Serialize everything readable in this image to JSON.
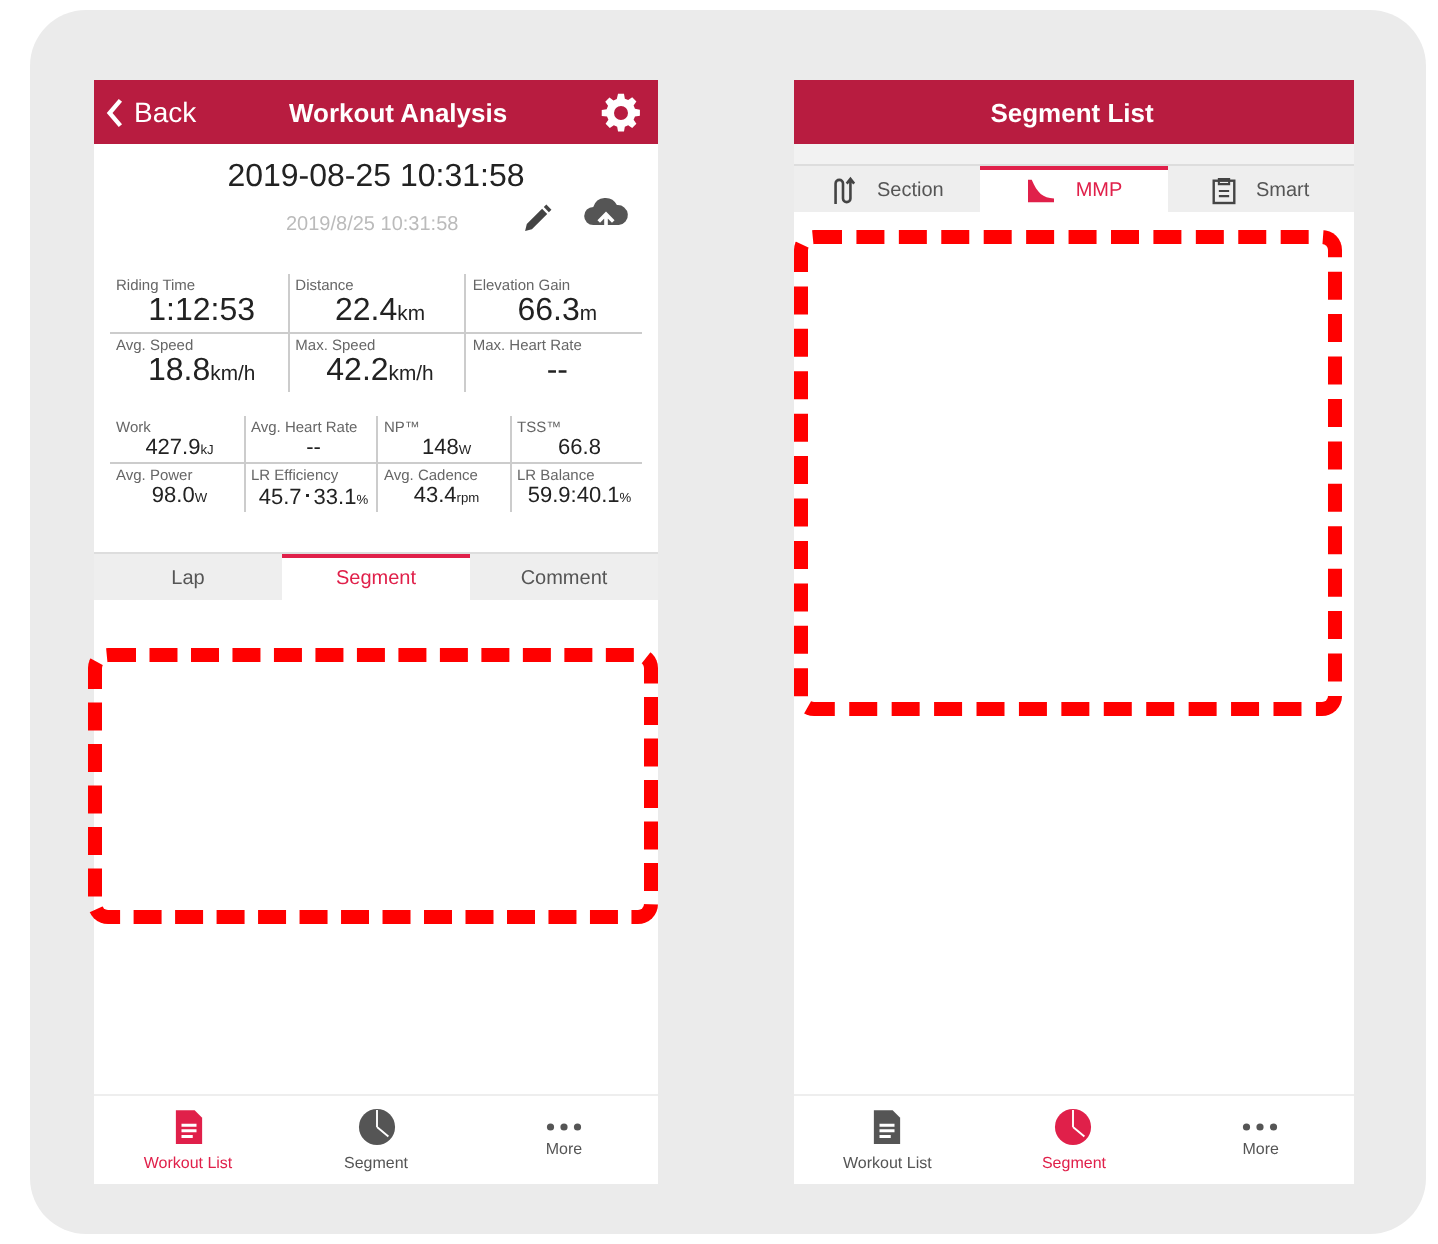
{
  "left_screen": {
    "nav": {
      "back": "Back",
      "title": "Workout Analysis"
    },
    "date": "2019-08-25 10:31:58",
    "sub_date": "2019/8/25 10:31:58",
    "summary": [
      {
        "label": "Riding Time",
        "value": "1:12:53"
      },
      {
        "label": "Distance",
        "value": "22.4",
        "unit": "km"
      },
      {
        "label": "Elevation Gain",
        "value": "66.3",
        "unit": "m"
      },
      {
        "label": "Avg. Speed",
        "value": "18.8",
        "unit": "km/h"
      },
      {
        "label": "Max. Speed",
        "value": "42.2",
        "unit": "km/h"
      },
      {
        "label": "Max. Heart Rate",
        "value": "--"
      }
    ],
    "power": [
      {
        "label": "Work",
        "value": "427.9",
        "unit": "kJ"
      },
      {
        "label": "Avg. Heart Rate",
        "value": "--"
      },
      {
        "label": "NP™",
        "value": "148",
        "unit": "W"
      },
      {
        "label": "TSS™",
        "value": "66.8"
      },
      {
        "label": "Avg. Power",
        "value": "98.0",
        "unit": "W"
      },
      {
        "label": "LR Efficiency",
        "value": "45.7･33.1",
        "unit": "%"
      },
      {
        "label": "Avg. Cadence",
        "value": "43.4",
        "unit": "rpm"
      },
      {
        "label": "LR Balance",
        "value": "59.9:40.1",
        "unit": "%"
      }
    ],
    "tabs": [
      {
        "label": "Lap",
        "selected": false
      },
      {
        "label": "Segment",
        "selected": true
      },
      {
        "label": "Comment",
        "selected": false
      }
    ],
    "highlighted": true,
    "tab_bar": [
      {
        "kind": "document",
        "label": "Workout List",
        "selected": true
      },
      {
        "kind": "pie",
        "label": "Segment",
        "selected": false
      },
      {
        "kind": "dots",
        "label": "More",
        "selected": false
      }
    ]
  },
  "right_screen": {
    "title": "Segment List",
    "tabs": [
      {
        "kind": "section",
        "label": "Section",
        "selected": false
      },
      {
        "kind": "mmp",
        "label": "MMP",
        "selected": true
      },
      {
        "kind": "smart",
        "label": "Smart",
        "selected": false
      }
    ],
    "highlighted": true,
    "tab_bar": [
      {
        "kind": "document",
        "label": "Workout List",
        "selected": false
      },
      {
        "kind": "pie",
        "label": "Segment",
        "selected": true
      },
      {
        "kind": "dots",
        "label": "More",
        "selected": false
      }
    ]
  }
}
